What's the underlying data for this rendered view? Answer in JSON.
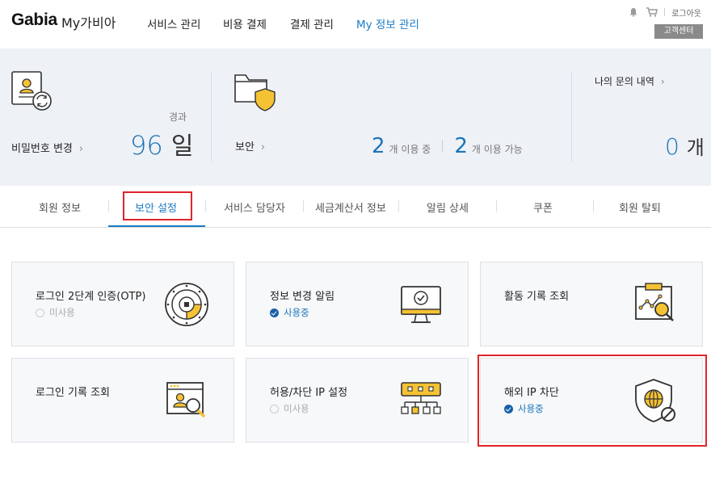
{
  "header": {
    "logo": "Gabia",
    "logo_sub": "My가비아",
    "nav": [
      "서비스 관리",
      "비용 결제",
      "결제 관리",
      "My 정보 관리"
    ],
    "logout": "로그아웃",
    "customer_center": "고객센터"
  },
  "summary": {
    "password": {
      "elapsed_label": "경과",
      "days": "96",
      "unit": "일",
      "link": "비밀번호 변경"
    },
    "security": {
      "link": "보안",
      "in_use_count": "2",
      "in_use_label": "개 이용 중",
      "available_count": "2",
      "available_label": "개 이용 가능"
    },
    "inquiry": {
      "link": "나의 문의 내역",
      "count": "0",
      "unit": "개"
    }
  },
  "tabs": [
    "회원 정보",
    "보안 설정",
    "서비스 담당자",
    "세금계산서 정보",
    "알림 상세",
    "쿠폰",
    "회원 탈퇴"
  ],
  "active_tab": "보안 설정",
  "cards": [
    {
      "title": "로그인 2단계 인증(OTP)",
      "status": "미사용",
      "icon": "otp-dial-icon"
    },
    {
      "title": "정보 변경 알림",
      "status": "사용중",
      "icon": "monitor-check-icon"
    },
    {
      "title": "활동 기록 조회",
      "status": "",
      "icon": "activity-chart-icon"
    },
    {
      "title": "로그인 기록 조회",
      "status": "",
      "icon": "login-user-search-icon"
    },
    {
      "title": "허용/차단 IP 설정",
      "status": "미사용",
      "icon": "network-tree-icon"
    },
    {
      "title": "해외 IP 차단",
      "status": "사용중",
      "icon": "globe-shield-block-icon"
    }
  ],
  "colors": {
    "accent": "#1a7bc4",
    "highlight": "#e0242b",
    "icon_yellow": "#f5c233"
  }
}
